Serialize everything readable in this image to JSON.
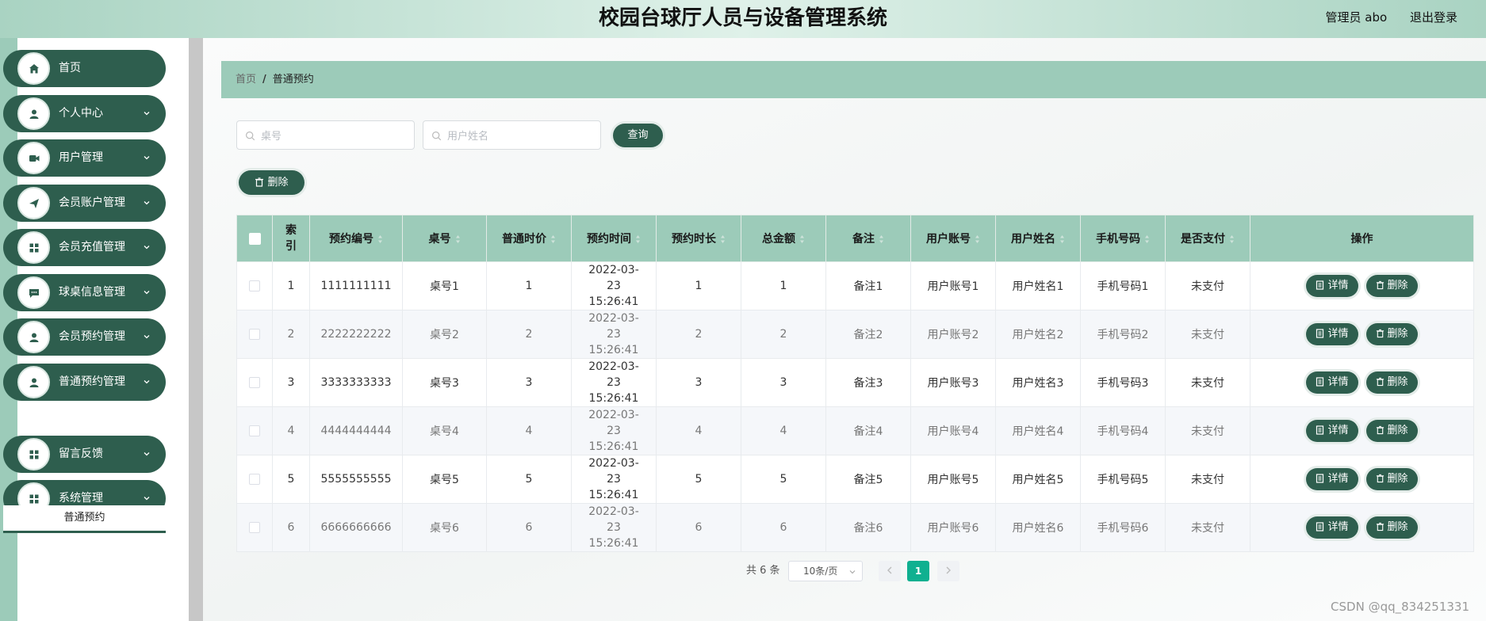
{
  "header": {
    "title": "校园台球厅人员与设备管理系统",
    "user": "管理员 abo",
    "logout": "退出登录"
  },
  "sidebar": {
    "items": [
      {
        "label": "首页",
        "icon": "home-icon",
        "chevron": false
      },
      {
        "label": "个人中心",
        "icon": "user-icon",
        "chevron": true
      },
      {
        "label": "用户管理",
        "icon": "video-icon",
        "chevron": true
      },
      {
        "label": "会员账户管理",
        "icon": "send-icon",
        "chevron": true
      },
      {
        "label": "会员充值管理",
        "icon": "grid-icon",
        "chevron": true
      },
      {
        "label": "球桌信息管理",
        "icon": "message-icon",
        "chevron": true
      },
      {
        "label": "会员预约管理",
        "icon": "user-icon",
        "chevron": true
      },
      {
        "label": "普通预约管理",
        "icon": "user-icon",
        "chevron": true
      },
      {
        "label": "留言反馈",
        "icon": "grid-icon",
        "chevron": true
      },
      {
        "label": "系统管理",
        "icon": "grid-icon",
        "chevron": true
      }
    ],
    "submenu": "普通预约"
  },
  "breadcrumb": {
    "home": "首页",
    "current": "普通预约"
  },
  "search": {
    "table_placeholder": "桌号",
    "name_placeholder": "用户姓名",
    "query_label": "查询"
  },
  "toolbar": {
    "delete_label": "删除"
  },
  "table": {
    "columns": [
      "索引",
      "预约编号",
      "桌号",
      "普通时价",
      "预约时间",
      "预约时长",
      "总金额",
      "备注",
      "用户账号",
      "用户姓名",
      "手机号码",
      "是否支付",
      "操作"
    ],
    "rows": [
      [
        "1",
        "1111111111",
        "桌号1",
        "1",
        "2022-03-23 15:26:41",
        "1",
        "1",
        "备注1",
        "用户账号1",
        "用户姓名1",
        "手机号码1",
        "未支付"
      ],
      [
        "2",
        "2222222222",
        "桌号2",
        "2",
        "2022-03-23 15:26:41",
        "2",
        "2",
        "备注2",
        "用户账号2",
        "用户姓名2",
        "手机号码2",
        "未支付"
      ],
      [
        "3",
        "3333333333",
        "桌号3",
        "3",
        "2022-03-23 15:26:41",
        "3",
        "3",
        "备注3",
        "用户账号3",
        "用户姓名3",
        "手机号码3",
        "未支付"
      ],
      [
        "4",
        "4444444444",
        "桌号4",
        "4",
        "2022-03-23 15:26:41",
        "4",
        "4",
        "备注4",
        "用户账号4",
        "用户姓名4",
        "手机号码4",
        "未支付"
      ],
      [
        "5",
        "5555555555",
        "桌号5",
        "5",
        "2022-03-23 15:26:41",
        "5",
        "5",
        "备注5",
        "用户账号5",
        "用户姓名5",
        "手机号码5",
        "未支付"
      ],
      [
        "6",
        "6666666666",
        "桌号6",
        "6",
        "2022-03-23 15:26:41",
        "6",
        "6",
        "备注6",
        "用户账号6",
        "用户姓名6",
        "手机号码6",
        "未支付"
      ]
    ],
    "detail_label": "详情",
    "delete_label": "删除"
  },
  "pagination": {
    "total": "共 6 条",
    "page_size": "10条/页",
    "current_page": "1"
  },
  "watermark": "CSDN @qq_834251331",
  "colors": {
    "primary": "#2e5e4e",
    "accent": "#9ccbb9",
    "active_page": "#10b090"
  }
}
